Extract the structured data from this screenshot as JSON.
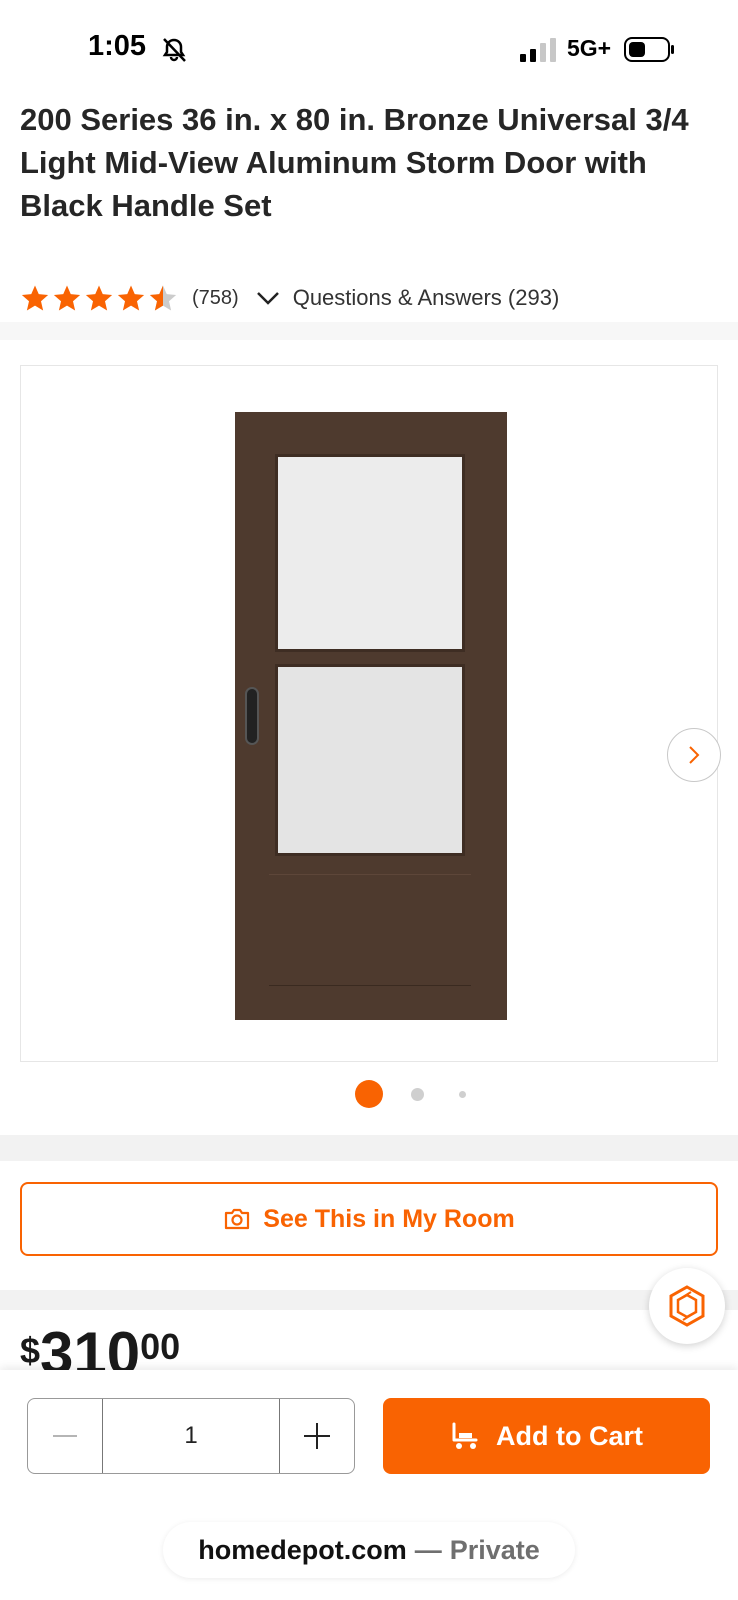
{
  "status_bar": {
    "time": "1:05",
    "network": "5G+",
    "bell_icon": "bell-slash-icon",
    "signal_icon": "signal-bars-icon",
    "battery_icon": "battery-icon"
  },
  "product": {
    "title": "200 Series 36 in. x 80 in. Bronze Universal 3/4 Light Mid-View Aluminum Storm Door with Black Handle Set",
    "rating": 4.5,
    "rating_count": "(758)",
    "qa_label": "Questions & Answers (293)"
  },
  "gallery": {
    "image_alt": "storm door product image",
    "current_index": 1,
    "total_dots": 3,
    "next_icon": "chevron-right-icon"
  },
  "room_button": {
    "label": "See This in My Room",
    "icon": "camera-icon"
  },
  "price": {
    "currency": "$",
    "whole": "310",
    "cents": "00"
  },
  "purchase": {
    "quantity": "1",
    "decrement_icon": "minus-icon",
    "increment_icon": "plus-icon",
    "add_to_cart_label": "Add to Cart",
    "cart_icon": "cart-icon"
  },
  "browser": {
    "domain": "homedepot.com",
    "separator": "—",
    "mode": "Private"
  },
  "colors": {
    "brand_orange": "#f96302",
    "star": "#f96302",
    "door_bronze": "#4e3a2e"
  }
}
